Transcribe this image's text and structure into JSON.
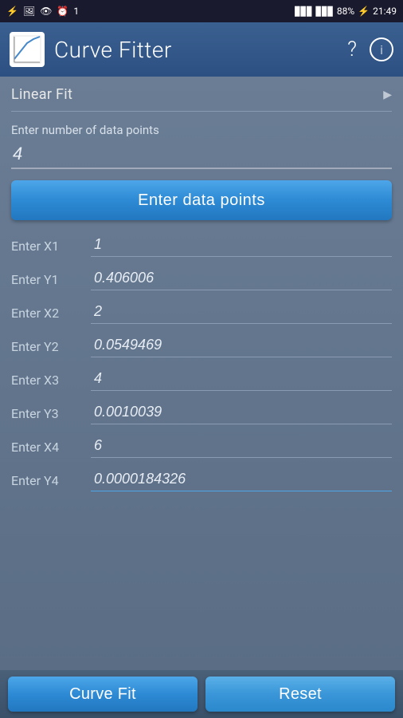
{
  "statusBar": {
    "leftIcons": [
      "🔌",
      "🖼",
      "👁",
      "⏰",
      "1"
    ],
    "signal": "▋▋▋",
    "battery": "88%",
    "time": "21:49"
  },
  "appBar": {
    "title": "Curve Fitter",
    "helpLabel": "?",
    "infoLabel": "ℹ"
  },
  "fitSelector": {
    "label": "Linear Fit"
  },
  "dataCount": {
    "promptLabel": "Enter number of data points",
    "value": "4"
  },
  "enterDataBtn": {
    "label": "Enter data points"
  },
  "fields": [
    {
      "label": "Enter X1",
      "value": "1"
    },
    {
      "label": "Enter Y1",
      "value": "0.406006"
    },
    {
      "label": "Enter X2",
      "value": "2"
    },
    {
      "label": "Enter Y2",
      "value": "0.0549469"
    },
    {
      "label": "Enter X3",
      "value": "4"
    },
    {
      "label": "Enter Y3",
      "value": "0.0010039"
    },
    {
      "label": "Enter X4",
      "value": "6"
    },
    {
      "label": "Enter Y4",
      "value": "0.0000184326"
    }
  ],
  "bottomBar": {
    "curveFitLabel": "Curve Fit",
    "resetLabel": "Reset"
  }
}
